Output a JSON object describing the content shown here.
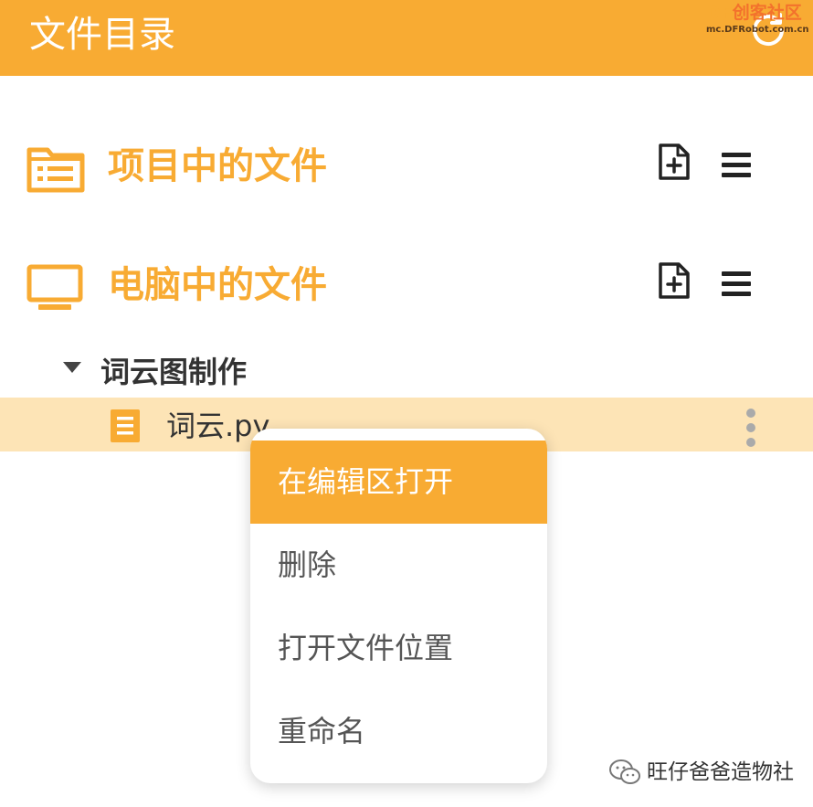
{
  "header": {
    "title": "文件目录",
    "refresh_icon": "refresh-icon"
  },
  "watermark": {
    "df": "DF",
    "main": "创客社区",
    "sub": "mc.DFRobot.com.cn"
  },
  "sections": [
    {
      "title": "项目中的文件",
      "icon": "folder-list-icon"
    },
    {
      "title": "电脑中的文件",
      "icon": "monitor-icon"
    }
  ],
  "tree": {
    "folder": {
      "name": "词云图制作",
      "expanded": true
    },
    "file": {
      "name": "词云.py",
      "selected": true
    }
  },
  "context_menu": {
    "items": [
      {
        "label": "在编辑区打开",
        "active": true
      },
      {
        "label": "删除",
        "active": false
      },
      {
        "label": "打开文件位置",
        "active": false
      },
      {
        "label": "重命名",
        "active": false
      }
    ]
  },
  "footer": {
    "account": "旺仔爸爸造物社"
  },
  "colors": {
    "accent": "#f8ab33",
    "selected_row": "#fde4b6",
    "text_dark": "#333333",
    "menu_text": "#555555"
  }
}
